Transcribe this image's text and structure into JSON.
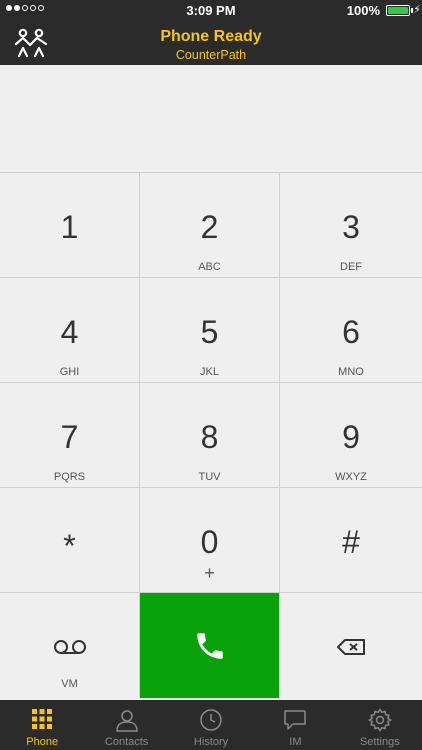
{
  "status_bar": {
    "signal_dots": [
      true,
      true,
      false,
      false,
      false
    ],
    "time": "3:09 PM",
    "battery_percent": "100%",
    "battery_color": "#2ecc40"
  },
  "header": {
    "logo_icon": "people-logo-icon",
    "title": "Phone Ready",
    "subtitle": "CounterPath",
    "accent_color": "#f5c518"
  },
  "display": {
    "number": ""
  },
  "keypad": {
    "keys": [
      {
        "digit": "1",
        "letters": ""
      },
      {
        "digit": "2",
        "letters": "ABC"
      },
      {
        "digit": "3",
        "letters": "DEF"
      },
      {
        "digit": "4",
        "letters": "GHI"
      },
      {
        "digit": "5",
        "letters": "JKL"
      },
      {
        "digit": "6",
        "letters": "MNO"
      },
      {
        "digit": "7",
        "letters": "PQRS"
      },
      {
        "digit": "8",
        "letters": "TUV"
      },
      {
        "digit": "9",
        "letters": "WXYZ"
      },
      {
        "digit": "*",
        "letters": ""
      },
      {
        "digit": "0",
        "letters": "+"
      },
      {
        "digit": "#",
        "letters": ""
      }
    ],
    "voicemail_label": "VM",
    "voicemail_icon": "voicemail-icon",
    "call_icon": "phone-handset-icon",
    "call_color": "#0aa20a",
    "backspace_icon": "backspace-icon"
  },
  "tabs": [
    {
      "label": "Phone",
      "icon": "dialpad-icon",
      "active": true
    },
    {
      "label": "Contacts",
      "icon": "person-icon",
      "active": false
    },
    {
      "label": "History",
      "icon": "clock-icon",
      "active": false
    },
    {
      "label": "IM",
      "icon": "chat-bubble-icon",
      "active": false
    },
    {
      "label": "Settings",
      "icon": "gear-icon",
      "active": false
    }
  ]
}
